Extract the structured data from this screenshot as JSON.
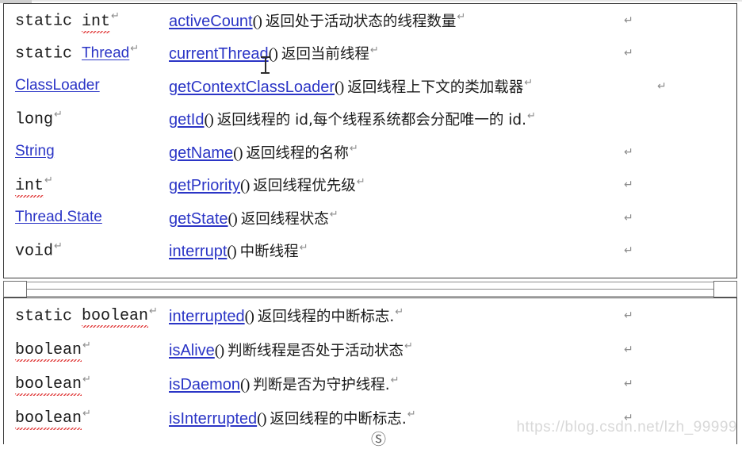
{
  "document": {
    "watermark": "https://blog.csdn.net/lzh_99999",
    "pilcrow": "↵",
    "paren": "()"
  },
  "table_top": {
    "rows": [
      {
        "type_prefix": "static ",
        "type_name": "int",
        "type_is_link": false,
        "type_squiggle": true,
        "type_pilcrow": "↵",
        "method": "activeCount",
        "desc": "返回处于活动状态的线程数量",
        "desc_pilcrow": "↵",
        "mark": "↵",
        "extra_mark": ""
      },
      {
        "type_prefix": "static ",
        "type_name": "Thread",
        "type_is_link": true,
        "type_squiggle": false,
        "type_pilcrow": "↵",
        "method": "currentThread",
        "desc": "返回当前线程",
        "desc_pilcrow": "↵",
        "mark": "↵",
        "extra_mark": ""
      },
      {
        "type_prefix": "",
        "type_name": "ClassLoader",
        "type_is_link": true,
        "type_squiggle": false,
        "type_pilcrow": "",
        "method": "getContextClassLoader",
        "desc": "返回线程上下文的类加载器",
        "desc_pilcrow": "↵",
        "mark": "",
        "extra_mark": "↵"
      },
      {
        "type_prefix": "",
        "type_name": "long",
        "type_is_link": false,
        "type_squiggle": false,
        "type_pilcrow": "↵",
        "method": "getId",
        "desc": "返回线程的 id,每个线程系统都会分配唯一的 id.",
        "desc_pilcrow": "↵",
        "mark": "",
        "extra_mark": ""
      },
      {
        "type_prefix": "",
        "type_name": "String",
        "type_is_link": true,
        "type_squiggle": false,
        "type_pilcrow": "",
        "method": "getName",
        "desc": "返回线程的名称",
        "desc_pilcrow": "↵",
        "mark": "↵",
        "extra_mark": ""
      },
      {
        "type_prefix": "",
        "type_name": "int",
        "type_is_link": false,
        "type_squiggle": true,
        "type_pilcrow": "↵",
        "method": "getPriority",
        "desc": "返回线程优先级",
        "desc_pilcrow": "↵",
        "mark": "↵",
        "extra_mark": ""
      },
      {
        "type_prefix": "",
        "type_name": "Thread.State",
        "type_is_link": true,
        "type_squiggle": false,
        "type_pilcrow": "",
        "method": "getState",
        "desc": "返回线程状态",
        "desc_pilcrow": "↵",
        "mark": "↵",
        "extra_mark": ""
      },
      {
        "type_prefix": "",
        "type_name": "void",
        "type_is_link": false,
        "type_squiggle": false,
        "type_pilcrow": "↵",
        "method": "interrupt",
        "desc": "中断线程",
        "desc_pilcrow": "↵",
        "mark": "↵",
        "extra_mark": ""
      }
    ]
  },
  "table_bottom": {
    "rows": [
      {
        "type_prefix": "static ",
        "type_name": "boolean",
        "type_is_link": false,
        "type_squiggle": true,
        "type_pilcrow": "↵",
        "method": "interrupted",
        "desc": "返回线程的中断标志.",
        "desc_pilcrow": "↵",
        "mark": "↵",
        "extra_mark": ""
      },
      {
        "type_prefix": "",
        "type_name": "boolean",
        "type_is_link": false,
        "type_squiggle": true,
        "type_pilcrow": "↵",
        "method": "isAlive",
        "desc": "判断线程是否处于活动状态",
        "desc_pilcrow": "↵",
        "mark": "↵",
        "extra_mark": ""
      },
      {
        "type_prefix": "",
        "type_name": "boolean",
        "type_is_link": false,
        "type_squiggle": true,
        "type_pilcrow": "↵",
        "method": "isDaemon",
        "desc": "判断是否为守护线程.",
        "desc_pilcrow": "↵",
        "mark": "↵",
        "extra_mark": ""
      },
      {
        "type_prefix": "",
        "type_name": "boolean",
        "type_is_link": false,
        "type_squiggle": true,
        "type_pilcrow": "↵",
        "method": "isInterrupted",
        "desc": "返回线程的中断标志.",
        "desc_pilcrow": "↵",
        "mark": "↵",
        "extra_mark": ""
      }
    ]
  },
  "colors": {
    "link": "#2b35c6",
    "text": "#1a1a1a",
    "border": "#3a3a3a",
    "squiggle": "#e03a3a",
    "mark": "#8c8c8c",
    "watermark": "#d8d8d8"
  }
}
